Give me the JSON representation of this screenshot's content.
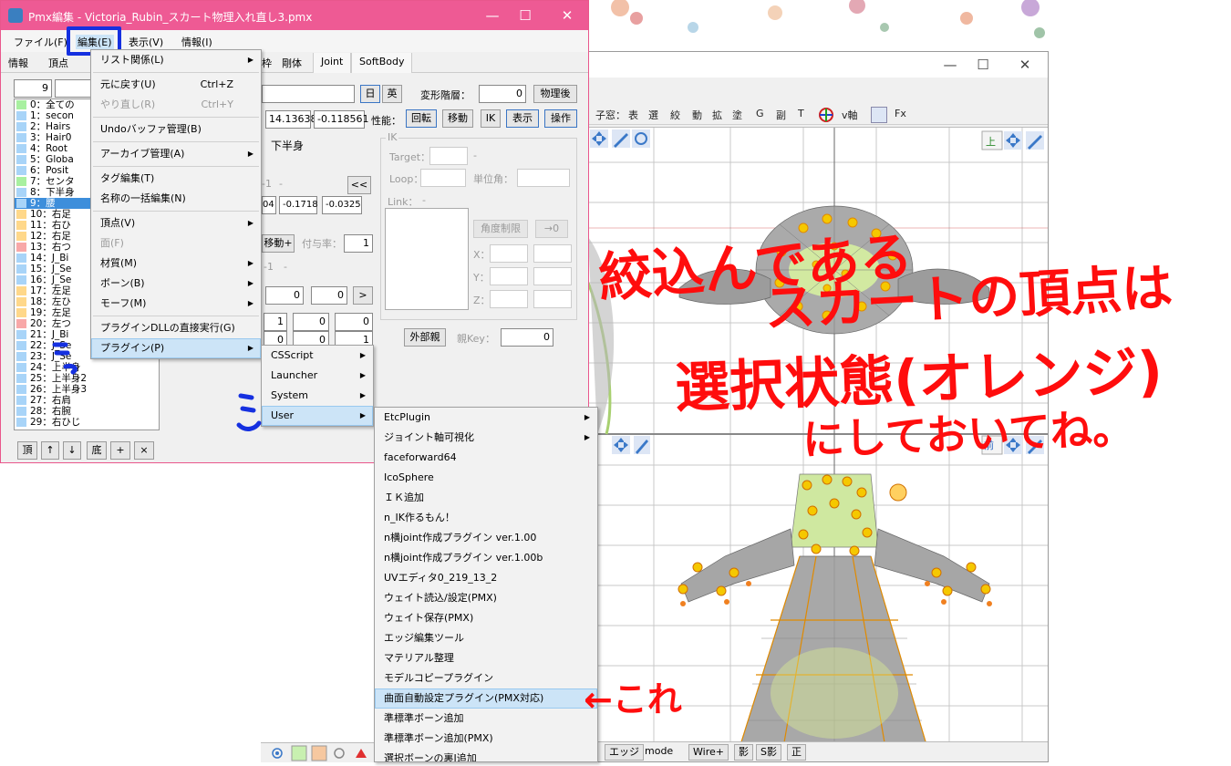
{
  "colors": {
    "title_pink": "#ee5a94",
    "annotation_red": "#ff0d0d",
    "annotation_blue": "#1530e0",
    "selection_blue": "#3d8edb",
    "menu_highlight": "#cce4f7"
  },
  "editor": {
    "title": "Pmx編集 - Victoria_Rubin_スカート物理入れ直し3.pmx",
    "window_controls": [
      "—",
      "☐",
      "✕"
    ],
    "menubar": [
      "ファイル(F)",
      "編集(E)",
      "表示(V)",
      "情報(I)"
    ],
    "tabs": [
      "情報",
      "頂点",
      "枠",
      "剛体",
      "Joint",
      "SoftBody"
    ],
    "index_value": "9",
    "bone_name_value": "",
    "lang_jp": "日",
    "lang_en": "英",
    "deform_label": "変形階層：",
    "deform_value": "0",
    "physics_after": "物理後",
    "pos_values": [
      "14.13638",
      "-0.118561"
    ],
    "ability_label": "性能：",
    "ability_buttons": [
      "回転",
      "移動",
      "IK",
      "表示",
      "操作"
    ],
    "parent_bone": "下半身",
    "dash": "-",
    "collapse_btn": "<<",
    "offset_values": [
      "04",
      "-0.1718",
      "-0.0325"
    ],
    "grant_move": "移動+",
    "grant_rate_label": "付与率：",
    "grant_rate_value": "1",
    "zero": "0",
    "one": "1",
    "next_btn": ">",
    "minus_one": "-1",
    "ik_group": "IK",
    "ik_target": "Target：",
    "ik_loop": "Loop：",
    "ik_unit": "単位角：",
    "ik_link": "Link：",
    "angle_limit": "角度制限",
    "arrow_zero": "→0",
    "axis_x": "X：",
    "axis_y": "Y：",
    "axis_z": "Z：",
    "external_parent": "外部親",
    "parent_key_label": "親Key：",
    "parent_key_value": "0",
    "bone_list": [
      {
        "text": "0：全ての",
        "color": "#a8f0a0"
      },
      {
        "text": "1：secon",
        "color": "#a8d4f8"
      },
      {
        "text": "2：Hairs",
        "color": "#a8d4f8"
      },
      {
        "text": "3：Hair0",
        "color": "#a8d4f8"
      },
      {
        "text": "4：Root",
        "color": "#a8d4f8"
      },
      {
        "text": "5：Globa",
        "color": "#a8d4f8"
      },
      {
        "text": "6：Posit",
        "color": "#a8d4f8"
      },
      {
        "text": "7：センタ",
        "color": "#a8f0a0"
      },
      {
        "text": "8：下半身",
        "color": "#a8d4f8"
      },
      {
        "text": "9：腰",
        "color": "#a8d4f8",
        "selected": true
      },
      {
        "text": "10：右足",
        "color": "#ffd88a"
      },
      {
        "text": "11：右ひ",
        "color": "#ffd88a"
      },
      {
        "text": "12：右足",
        "color": "#ffd88a"
      },
      {
        "text": "13：右つ",
        "color": "#f8a8a8"
      },
      {
        "text": "14：J_Bi",
        "color": "#a8d4f8"
      },
      {
        "text": "15：J_Se",
        "color": "#a8d4f8"
      },
      {
        "text": "16：J_Se",
        "color": "#a8d4f8"
      },
      {
        "text": "17：左足",
        "color": "#ffd88a"
      },
      {
        "text": "18：左ひ",
        "color": "#ffd88a"
      },
      {
        "text": "19：左足",
        "color": "#ffd88a"
      },
      {
        "text": "20：左つ",
        "color": "#f8a8a8"
      },
      {
        "text": "21：J_Bi",
        "color": "#a8d4f8"
      },
      {
        "text": "22：J_Se",
        "color": "#a8d4f8"
      },
      {
        "text": "23：J_Se",
        "color": "#a8d4f8"
      },
      {
        "text": "24：上半身",
        "color": "#a8d4f8"
      },
      {
        "text": "25：上半身2",
        "color": "#a8d4f8"
      },
      {
        "text": "26：上半身3",
        "color": "#a8d4f8"
      },
      {
        "text": "27：右肩",
        "color": "#a8d4f8"
      },
      {
        "text": "28：右腕",
        "color": "#a8d4f8"
      },
      {
        "text": "29：右ひじ",
        "color": "#a8d4f8"
      }
    ],
    "list_buttons": [
      "頂",
      "↑",
      "↓",
      "底",
      "+",
      "×"
    ]
  },
  "edit_menu": {
    "items": [
      {
        "label": "リスト関係(L)",
        "sub": true
      },
      {
        "sep": true
      },
      {
        "label": "元に戻す(U)",
        "acc": "Ctrl+Z"
      },
      {
        "label": "やり直し(R)",
        "acc": "Ctrl+Y",
        "disabled": true
      },
      {
        "sep": true
      },
      {
        "label": "Undoバッファ管理(B)"
      },
      {
        "sep": true
      },
      {
        "label": "アーカイブ管理(A)",
        "sub": true
      },
      {
        "sep": true
      },
      {
        "label": "タグ編集(T)"
      },
      {
        "label": "名称の一括編集(N)"
      },
      {
        "sep": true
      },
      {
        "label": "頂点(V)",
        "sub": true
      },
      {
        "label": "面(F)",
        "disabled": true
      },
      {
        "label": "材質(M)",
        "sub": true
      },
      {
        "label": "ボーン(B)",
        "sub": true
      },
      {
        "label": "モーフ(M)",
        "sub": true
      },
      {
        "sep": true
      },
      {
        "label": "プラグインDLLの直接実行(G)"
      },
      {
        "label": "プラグイン(P)",
        "sub": true,
        "highlight": true
      }
    ]
  },
  "plugin_menu": {
    "items": [
      {
        "label": "CSScript",
        "sub": true
      },
      {
        "label": "Launcher",
        "sub": true
      },
      {
        "label": "System",
        "sub": true
      },
      {
        "label": "User",
        "sub": true,
        "highlight": true
      }
    ]
  },
  "user_menu": {
    "items": [
      {
        "label": "EtcPlugin",
        "sub": true
      },
      {
        "label": "ジョイント軸可視化",
        "sub": true
      },
      {
        "label": "faceforward64"
      },
      {
        "label": "IcoSphere"
      },
      {
        "label": "ＩＫ追加"
      },
      {
        "label": "n_IK作るもん！"
      },
      {
        "label": "n横joint作成プラグイン ver.1.00"
      },
      {
        "label": "n横joint作成プラグイン ver.1.00b"
      },
      {
        "label": "UVエディタ0_219_13_2"
      },
      {
        "label": "ウェイト読込/設定(PMX)"
      },
      {
        "label": "ウェイト保存(PMX)"
      },
      {
        "label": "エッジ編集ツール"
      },
      {
        "label": "マテリアル整理"
      },
      {
        "label": "モデルコピープラグイン"
      },
      {
        "label": "曲面自動設定プラグイン(PMX対応)",
        "highlight": true
      },
      {
        "label": "準標準ボーン追加"
      },
      {
        "label": "準標準ボーン追加(PMX)"
      },
      {
        "label": "選択ボーンの裏J追加"
      }
    ]
  },
  "viewer": {
    "window_controls": [
      "—",
      "☐",
      "✕"
    ],
    "toolbar": [
      "子窓：",
      "表",
      "選",
      "絞",
      "動",
      "拡",
      "塗",
      "G",
      "副",
      "T",
      "v軸",
      "Fx"
    ],
    "view_top": "上",
    "view_front": "前",
    "status": [
      "エッジ",
      "mode",
      "Wire+",
      "影",
      "S影",
      "正"
    ]
  },
  "annotations": {
    "line1": "絞込んである",
    "line2": "スカートの頂点は",
    "line3": "選択状態(オレンジ)",
    "line4": "にしておいてね。",
    "pointer": "←これ"
  }
}
